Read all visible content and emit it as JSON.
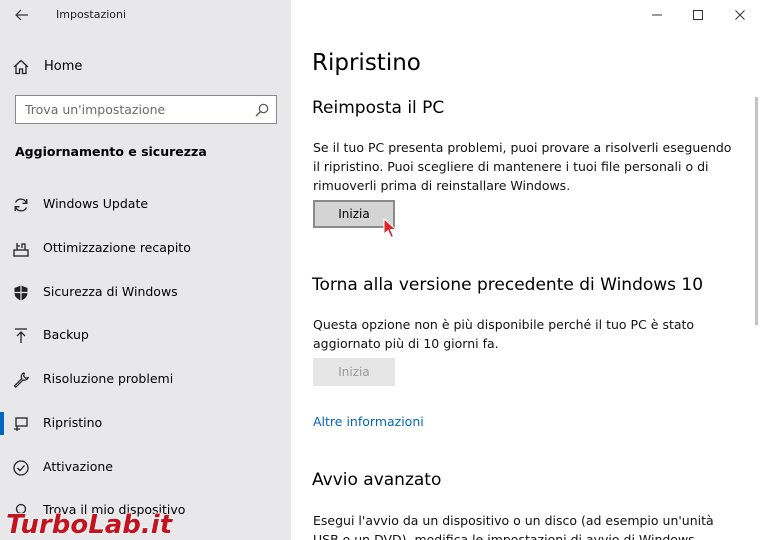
{
  "window": {
    "app_title": "Impostazioni",
    "controls": [
      "minimize",
      "maximize",
      "close"
    ]
  },
  "sidebar": {
    "home_label": "Home",
    "search_placeholder": "Trova un'impostazione",
    "section_title": "Aggiornamento e sicurezza",
    "items": [
      {
        "label": "Windows Update",
        "icon": "refresh-icon"
      },
      {
        "label": "Ottimizzazione recapito",
        "icon": "delivery-optimization-icon"
      },
      {
        "label": "Sicurezza di Windows",
        "icon": "shield-icon"
      },
      {
        "label": "Backup",
        "icon": "backup-arrow-icon"
      },
      {
        "label": "Risoluzione problemi",
        "icon": "wrench-icon"
      },
      {
        "label": "Ripristino",
        "icon": "recovery-icon",
        "selected": true
      },
      {
        "label": "Attivazione",
        "icon": "activation-check-icon"
      },
      {
        "label": "Trova il mio dispositivo",
        "icon": "find-device-icon"
      }
    ]
  },
  "main": {
    "title": "Ripristino",
    "reset": {
      "heading": "Reimposta il PC",
      "description": "Se il tuo PC presenta problemi, puoi provare a risolverli eseguendo il ripristino. Puoi scegliere di mantenere i tuoi file personali o di rimuoverli prima di reinstallare Windows.",
      "button": "Inizia"
    },
    "rollback": {
      "heading": "Torna alla versione precedente di Windows 10",
      "description": "Questa opzione non è più disponibile perché il tuo PC è stato aggiornato più di 10 giorni fa.",
      "button": "Inizia",
      "button_disabled": true,
      "link": "Altre informazioni"
    },
    "advanced": {
      "heading": "Avvio avanzato",
      "description": "Esegui l'avvio da un dispositivo o un disco (ad esempio un'unità USB o un DVD), modifica le impostazioni di avvio di Windows"
    }
  },
  "watermark": "TurboLab.it",
  "colors": {
    "accent": "#0067c0",
    "sidebar_bg": "#e8e8eb",
    "watermark": "#c2131f"
  }
}
